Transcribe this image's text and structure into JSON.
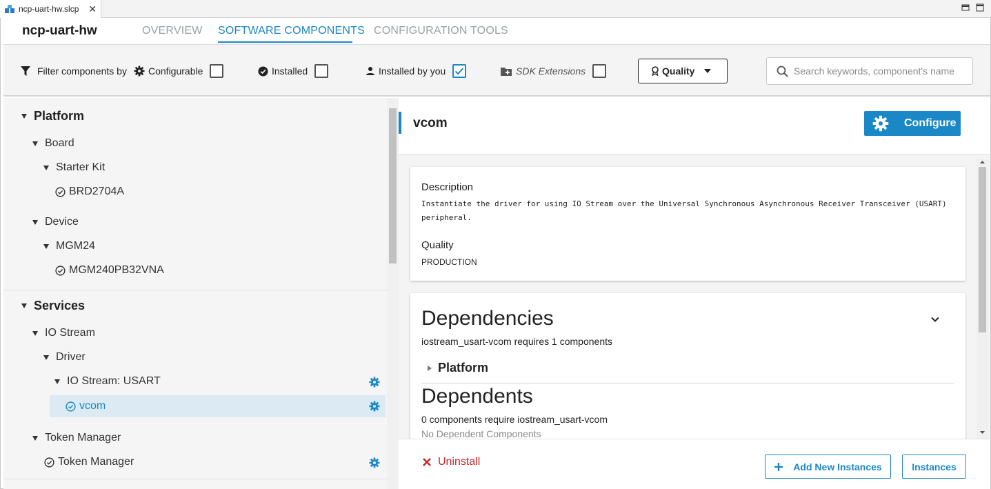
{
  "editor_tab": {
    "filename": "ncp-uart-hw.slcp"
  },
  "header": {
    "project_title": "ncp-uart-hw",
    "tabs": [
      {
        "label": "OVERVIEW",
        "active": false
      },
      {
        "label": "SOFTWARE COMPONENTS",
        "active": true
      },
      {
        "label": "CONFIGURATION TOOLS",
        "active": false
      }
    ]
  },
  "filters": {
    "filter_label": "Filter components by",
    "configurable": {
      "label": "Configurable",
      "checked": false
    },
    "installed": {
      "label": "Installed",
      "checked": false
    },
    "installed_by_you": {
      "label": "Installed by you",
      "checked": true
    },
    "sdk_extensions": {
      "label": "SDK Extensions",
      "checked": false
    },
    "quality_label": "Quality",
    "search_placeholder": "Search keywords, component's name"
  },
  "tree": {
    "platform": "Platform",
    "board": "Board",
    "starter_kit": "Starter Kit",
    "brd": "BRD2704A",
    "device": "Device",
    "mgm24": "MGM24",
    "mgm240": "MGM240PB32VNA",
    "services": "Services",
    "io_stream": "IO Stream",
    "driver": "Driver",
    "io_stream_usart": "IO Stream: USART",
    "vcom": "vcom",
    "token_manager_group": "Token Manager",
    "token_manager": "Token Manager"
  },
  "component": {
    "title": "vcom",
    "configure_label": "Configure",
    "description_label": "Description",
    "description_line1": "Instantiate the driver for using IO Stream over the Universal Synchronous Asynchronous Receiver Transceiver (USART)",
    "description_line2": "peripheral.",
    "quality_label": "Quality",
    "quality_value": "PRODUCTION",
    "dependencies_title": "Dependencies",
    "dependencies_summary": "iostream_usart-vcom requires 1 components",
    "dependency_group": "Platform",
    "dependents_title": "Dependents",
    "dependents_summary": "0 components require iostream_usart-vcom",
    "dependents_empty": "No Dependent Components"
  },
  "footer": {
    "uninstall_label": "Uninstall",
    "add_instances_label": "Add New Instances",
    "instances_label": "Instances"
  },
  "colors": {
    "accent": "#1a87c7",
    "danger": "#c62828",
    "selected_row": "#dceaf4"
  }
}
